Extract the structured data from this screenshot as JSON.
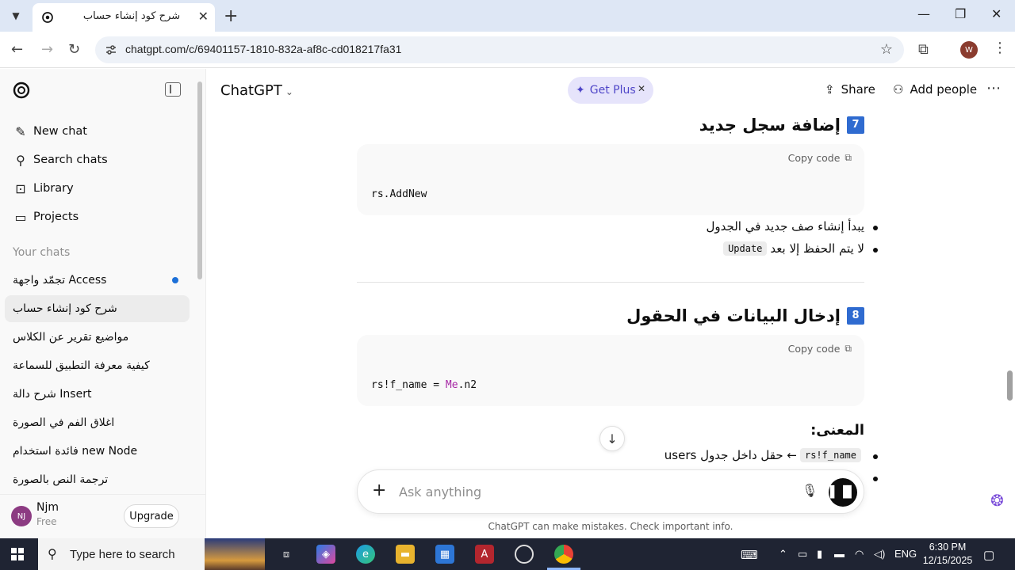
{
  "browser": {
    "tab_title": "شرح كود إنشاء حساب",
    "url": "chatgpt.com/c/69401157-1810-832a-af8c-cd018217fa31",
    "profile_initial": "W"
  },
  "sidebar": {
    "nav": [
      {
        "label": "New chat",
        "icon": "new-chat-icon"
      },
      {
        "label": "Search chats",
        "icon": "search-icon"
      },
      {
        "label": "Library",
        "icon": "library-icon"
      },
      {
        "label": "Projects",
        "icon": "folder-icon"
      }
    ],
    "section_label": "Your chats",
    "chats": [
      {
        "label": "تجمّد واجهة Access",
        "active": false,
        "unread": true
      },
      {
        "label": "شرح كود إنشاء حساب",
        "active": true
      },
      {
        "label": "مواضيع تقرير عن الكلاس",
        "active": false
      },
      {
        "label": "كيفية معرفة التطبيق للسماعة",
        "active": false
      },
      {
        "label": "شرح دالة Insert",
        "active": false
      },
      {
        "label": "اغلاق الفم في الصورة",
        "active": false
      },
      {
        "label": "فائدة استخدام new Node",
        "active": false
      },
      {
        "label": "ترجمة النص بالصورة",
        "active": false
      }
    ],
    "user": {
      "initials": "NJ",
      "name": "Njm",
      "plan": "Free",
      "upgrade_label": "Upgrade"
    }
  },
  "header": {
    "model": "ChatGPT",
    "get_plus": "Get Plus",
    "share": "Share",
    "add_people": "Add people"
  },
  "content": {
    "section7": {
      "number": "7",
      "title": "إضافة سجل جديد",
      "copy_label": "Copy code",
      "code": "rs.AddNew",
      "bullet1": "يبدأ إنشاء صف جديد في الجدول",
      "bullet2_prefix": "لا يتم الحفظ إلا بعد",
      "bullet2_code": "Update"
    },
    "section8": {
      "number": "8",
      "title": "إدخال البيانات في الحقول",
      "copy_label": "Copy code",
      "code_prefix": "rs!f_name = ",
      "code_kw": "Me",
      "code_suffix": ".n2",
      "meaning_label": "المعنى:",
      "bullet1_code": "rs!f_name",
      "bullet1_text": "← حقل داخل جدول users"
    }
  },
  "composer": {
    "placeholder": "Ask anything",
    "disclaimer": "ChatGPT can make mistakes. Check important info."
  },
  "taskbar": {
    "search_placeholder": "Type here to search",
    "language": "ENG",
    "time": "6:30 PM",
    "date": "12/15/2025"
  }
}
